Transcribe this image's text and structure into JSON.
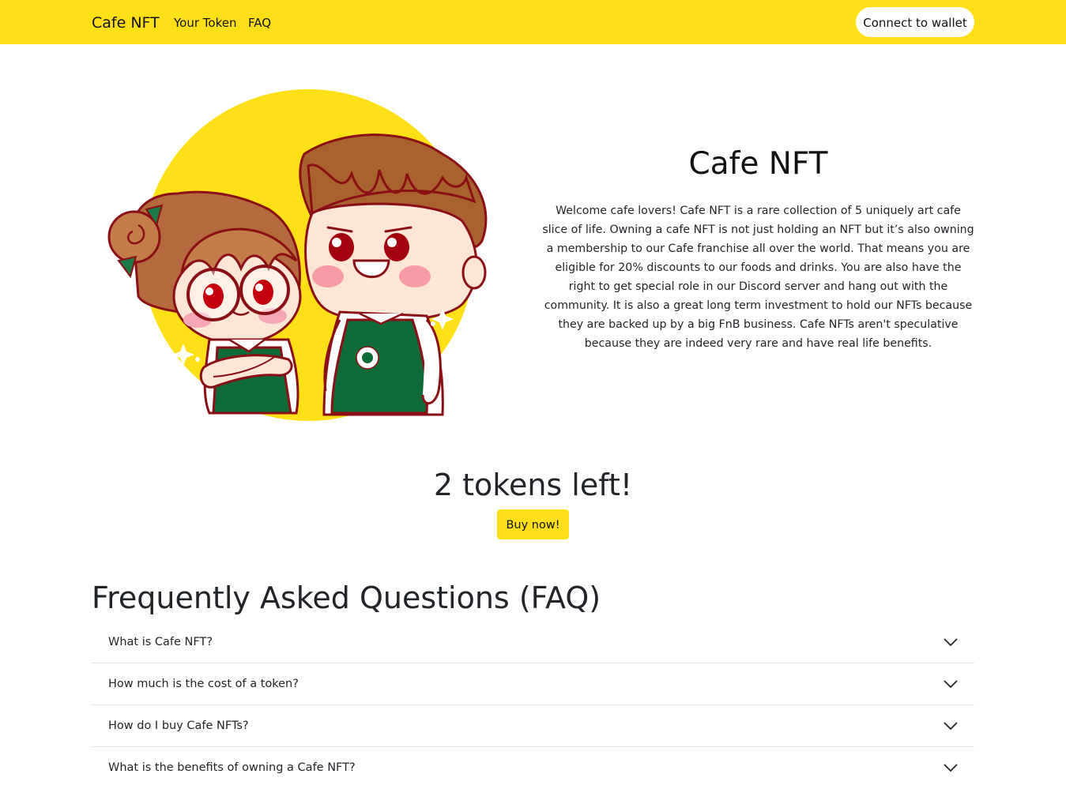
{
  "navbar": {
    "brand": "Cafe NFT",
    "links": [
      "Your Token",
      "FAQ"
    ],
    "wallet_button": "Connect to wallet",
    "background_color": "#ffe016"
  },
  "hero": {
    "title": "Cafe NFT",
    "description": "Welcome cafe lovers! Cafe NFT is a rare collection of 5 uniquely art cafe slice of life. Owning a cafe NFT is not just holding an NFT but it’s also owning a membership to our Cafe franchise all over the world. That means you are eligible for 20% discounts to our foods and drinks. You are also have the right to get special role in our Discord server and hang out with the community. It is also a great long term investment to hold our NFTs because they are backed up by a big FnB business. Cafe NFTs aren't speculative because they are indeed very rare and have real life benefits."
  },
  "tokens": {
    "remaining_text": "2 tokens left!",
    "buy_button": "Buy now!"
  },
  "faq": {
    "title": "Frequently Asked Questions (FAQ)",
    "items": [
      {
        "question": "What is Cafe NFT?",
        "icon": "chevron-down-icon"
      },
      {
        "question": "How much is the cost of a token?",
        "icon": "chevron-down-icon"
      },
      {
        "question": "How do I buy Cafe NFTs?",
        "icon": "chevron-down-icon"
      },
      {
        "question": "What is the benefits of owning a Cafe NFT?",
        "icon": "chevron-down-icon"
      }
    ]
  }
}
